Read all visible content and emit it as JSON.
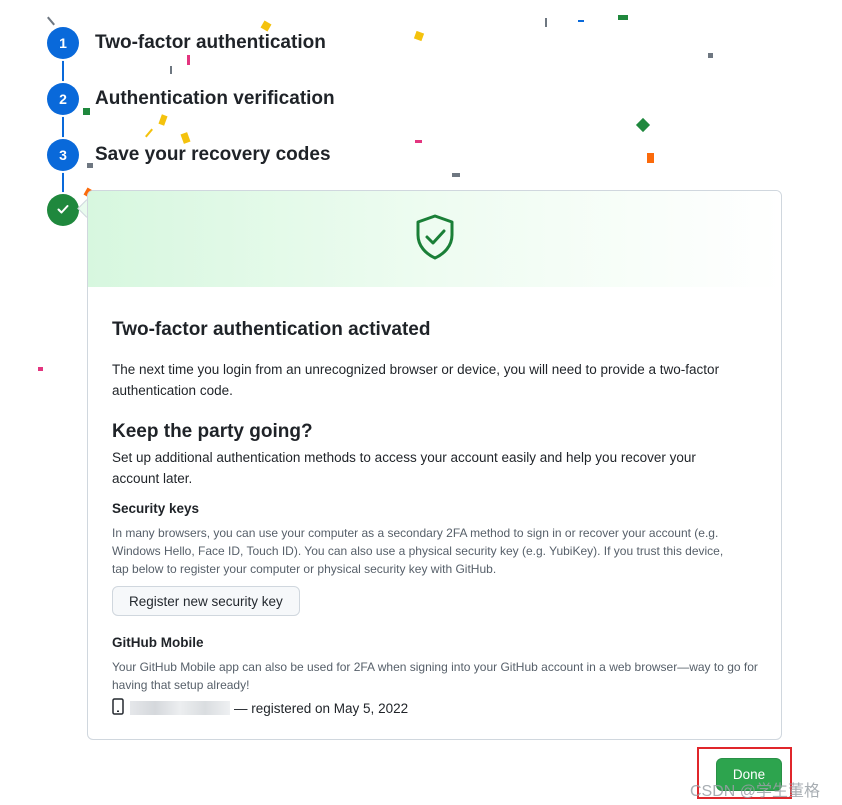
{
  "steps": [
    {
      "number": "1",
      "label": "Two-factor authentication"
    },
    {
      "number": "2",
      "label": "Authentication verification"
    },
    {
      "number": "3",
      "label": "Save your recovery codes"
    }
  ],
  "final_step_icon": "check-icon",
  "banner_icon": "shield-check-icon",
  "card": {
    "title": "Two-factor authentication activated",
    "intro": "The next time you login from an unrecognized browser or device, you will need to provide a two-factor authentication code.",
    "party_heading": "Keep the party going?",
    "party_text": "Set up additional authentication methods to access your account easily and help you recover your account later.",
    "security_keys": {
      "heading": "Security keys",
      "text": "In many browsers, you can use your computer as a secondary 2FA method to sign in or recover your account (e.g. Windows Hello, Face ID, Touch ID). You can also use a physical security key (e.g. YubiKey). If you trust this device, tap below to register your computer or physical security key with GitHub.",
      "button": "Register new security key"
    },
    "mobile": {
      "heading": "GitHub Mobile",
      "text": "Your GitHub Mobile app can also be used for 2FA when signing into your GitHub account in a web browser—way to go for having that setup already!",
      "device_icon": "mobile-device-icon",
      "registered_text": "— registered on May 5, 2022"
    }
  },
  "done_button": "Done",
  "watermark": "CSDN @学生董格",
  "colors": {
    "step_blue": "#0969da",
    "success_green": "#1f883d",
    "done_button": "#2da44e",
    "highlight_red": "#e0262b"
  }
}
